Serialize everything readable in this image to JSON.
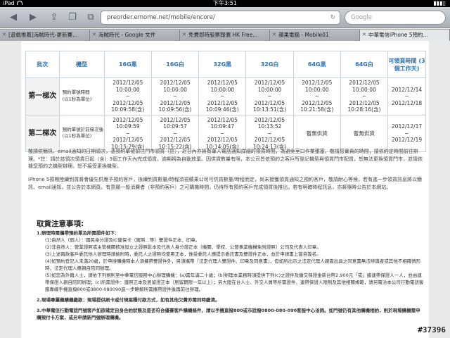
{
  "status": {
    "device": "iPad",
    "time": "下午3:51"
  },
  "toolbar": {
    "url": "preorder.emome.net/mobile/encore/",
    "search_placeholder": "Google"
  },
  "icons": {
    "back": "chevron-left-icon",
    "forward": "chevron-right-icon",
    "share": "share-icon",
    "bookmarks": "book-icon",
    "tabs": "tabs-icon",
    "reload": "reload-icon"
  },
  "tabs": [
    "[遊戲推薦]海賊時代-更新賽…",
    "海賊時代 - Google 文件",
    "免費即時股票報價 HK Free…",
    "蘋果電腦 - Mobile01",
    "中華電信iPhone 5預約…"
  ],
  "table": {
    "headers": [
      "批次",
      "機型",
      "16G黑",
      "16G白",
      "32G黑",
      "32G白",
      "64G黑",
      "64G白",
      "可領貨時間 (3個工作天)"
    ],
    "rows": [
      {
        "batch": "第一梯次",
        "periods": [
          "預約單號時間",
          "(以1秒為單位)"
        ],
        "cells": [
          [
            "2012/12/05",
            "10:00:00",
            "~",
            "2012/12/05",
            "10:09:58(含)"
          ],
          [
            "2012/12/05",
            "10:00:00",
            "~",
            "2012/12/05",
            "10:09:56(含)"
          ],
          [
            "2012/12/05",
            "10:00:00",
            "~",
            "2012/12/05",
            "10:09:46(含)"
          ],
          [
            "2012/12/05",
            "10:00:00",
            "~",
            "2012/12/05",
            "10:13:51(含)"
          ],
          [
            "2012/12/05",
            "10:00:00",
            "~",
            "2012/12/05",
            "10:21:58(含)"
          ],
          [
            "2012/12/05",
            "10:00:00",
            "~",
            "2012/12/05",
            "10:28:16(含)"
          ],
          [
            "2012/12/14",
            "~",
            "2012/12/18"
          ]
        ]
      },
      {
        "batch": "第二梯次",
        "periods": [
          "預約單號於前梯次後",
          "(以1秒為單位)"
        ],
        "cells": [
          [
            "2012/12/05",
            "10:09:59",
            "~",
            "2012/12/05",
            "10:15:29(含)"
          ],
          [
            "2012/12/05",
            "10:09:57",
            "~",
            "2012/12/05",
            "10:15:22(含)"
          ],
          [
            "2012/12/05",
            "10:09:47",
            "~",
            "2012/12/05",
            "10:14:05(含)"
          ],
          [
            "2012/12/05",
            "10:13:52",
            "~",
            "2012/12/05",
            "10:24:13(含)"
          ],
          [
            "暫無供貨"
          ],
          [
            "暫無供貨"
          ],
          [
            "2012/12/17",
            "~",
            "2012/12/19"
          ]
        ]
      }
    ]
  },
  "paragraphs": [
    "敬請依簡訊、email通知的日期領次，憑預約單號前往門市領貨（註），近日內亦將有專人電話通知詳細的領貨時間，為避免室口作業壅塞，敬請您實貴的時間，請依約定時間前往辦理。*註：請於該領次領貨日起（含）3個工作天內完成領貨，逾期視為自動放棄。因供貨數量有限，本公司皆依預約之客戶所登記機型與領貨門市配貨，恕無法更換領貨門市，並請依據您預約之機型辦理。恕不接受更換機型。",
    "iPhone 5預期陸續到貨將會優先供應予預約客戶，後續到貨數量/時程須視蘋果公司可供貨數量/時程而定，尚未接獲領貨通知之預約客戶，敬請耐心等候，若有進一步領貨訊息將以簡訊、email通知，並公告於本網頁。有意願一般消費者（非預約客戶）之可購機時間，仍待所有預約客戶完成領貨後推出，若有明確時程訊息，亦將隨時公告於本網站。"
  ],
  "notes": {
    "title": "取貨注意事項:",
    "items": [
      {
        "heading": "1.辦理時需攜帶預約單及所需證件如下：",
        "lines": [
          "(1)自然人（個人）：國民身分證及IC健保卡（駕照…等）雙證件正本、印章。",
          "(2)非自然人：營業證照或主管機關核准設立之證照影本及代表人身分證正本（機關、學校、公營事業機構免附證照）公司及代表人印章。",
          "(3)上述兩款客戶委託他人辦理時請檢附時，委託人之證照均使用正本，惟受委託人應提示委託書及雙證件正本，並於申請書上簽自簽名。",
          "(4)如預約登記人未滿20歲，於申辦購機時本人須攜帶雙證件外，另須攜帶『法定代理人雙證件、印章及同意書』，但如所出示之法定代理人親簽出具之同意書無法辨識者或其他不相確情形時，法定代理人應親自陪同辦理。",
          "(5)如您為外籍人士，請依下列規則至中華電信服務中心辦理購機：(a)需年滿二十歲；(b)辦理本業務時須提供下列(c)之證件及繳交保證金新台幣2,900元「或」據連帶保證人一人，並由連帶保證人親自陪同辦理；(c)所需證件：護照正本及居留證正本（居留期限一年以上）；另大陸在台人士、外交人員等所需證件、連帶保證人限制及其他相關規範，請另電洽本公司行動電話客服專線手機直撥800或0800-080090進一步瞭解所需攜帶證件後再前往辦理。"
        ]
      },
      {
        "heading": "2.現場專屬機購機繳款：現場提供刷卡或付現兩種付款方式，如有其他欠費亦需同時繳清。",
        "lines": []
      },
      {
        "heading": "3.中華電信行動電話門號客戶如欲確定自身合約狀態及是否符合優賽客戶購機條件，請以手機直撥800或市話撥0800-080-090客服中心洽詢。如門號仍有其他購機相約，則於現場購機需申購預付卡方案，或另申請新門號辦理購機。",
        "lines": []
      }
    ]
  },
  "watermark": "#37396"
}
